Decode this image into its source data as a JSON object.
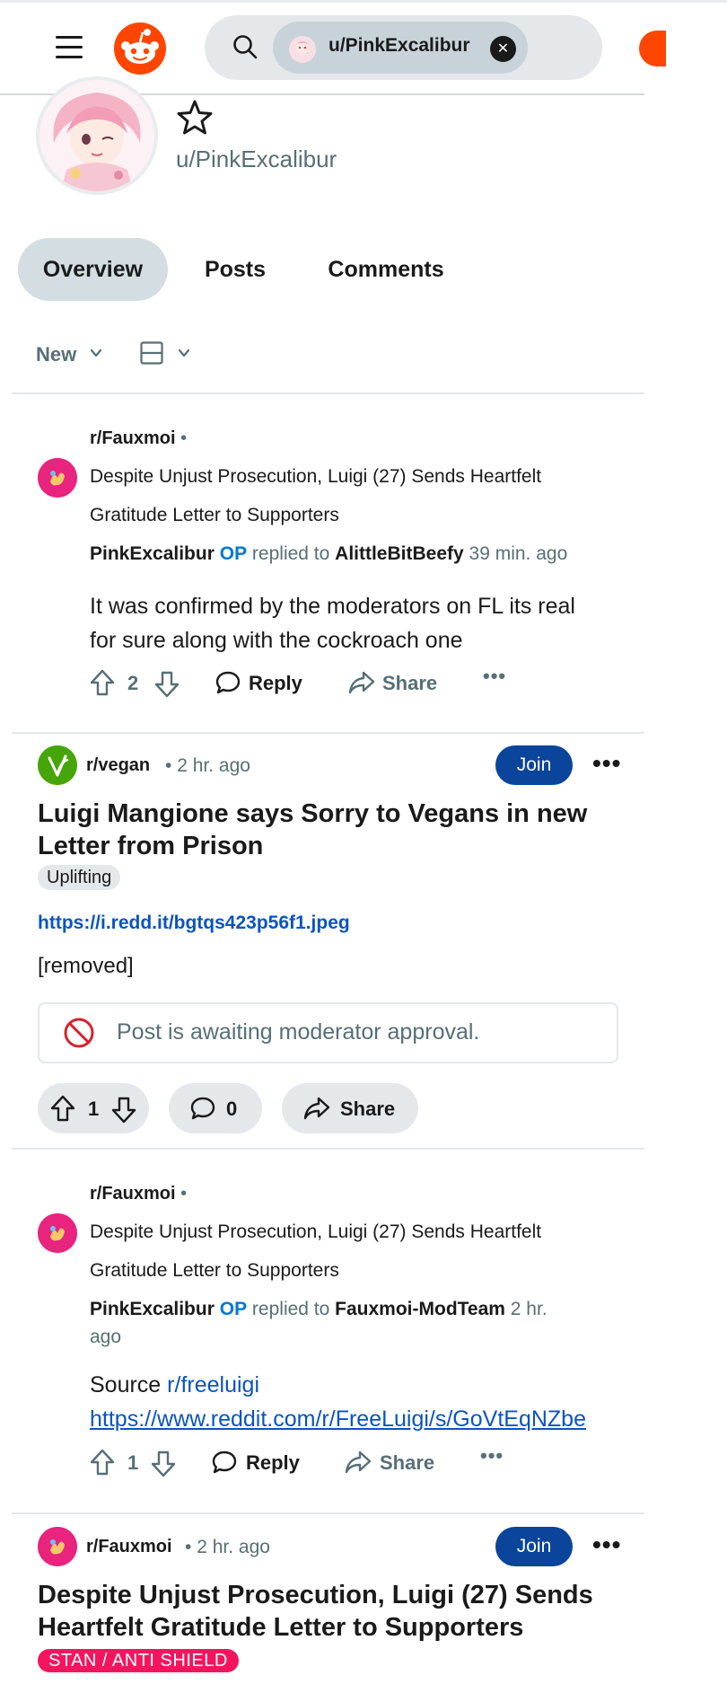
{
  "header": {
    "search_chip_label": "u/PinkExcalibur"
  },
  "profile": {
    "username": "u/PinkExcalibur"
  },
  "tabs": [
    {
      "label": "Overview",
      "active": true
    },
    {
      "label": "Posts",
      "active": false
    },
    {
      "label": "Comments",
      "active": false
    }
  ],
  "sort": {
    "label": "New"
  },
  "feed": {
    "comment1": {
      "subreddit": "r/Fauxmoi",
      "post_title_line1": "Despite Unjust Prosecution, Luigi (27) Sends Heartfelt",
      "post_title_line2": "Gratitude Letter to Supporters",
      "author": "PinkExcalibur",
      "op_badge": "OP",
      "replied_to_text": "replied to",
      "replied_to_user": "AlittleBitBeefy",
      "time": "39 min. ago",
      "body_line1": "It was confirmed by the moderators on FL its real",
      "body_line2": "for sure along with the cockroach one",
      "score": "2",
      "reply_label": "Reply",
      "share_label": "Share"
    },
    "post1": {
      "subreddit": "r/vegan",
      "time": "2 hr. ago",
      "join_label": "Join",
      "title_line1": "Luigi Mangione says Sorry to Vegans in new",
      "title_line2": "Letter from Prison",
      "flair": "Uplifting",
      "link": "https://i.redd.it/bgtqs423p56f1.jpeg",
      "removed_text": "[removed]",
      "notice": "Post is awaiting moderator approval.",
      "score": "1",
      "comments": "0",
      "share_label": "Share"
    },
    "comment2": {
      "subreddit": "r/Fauxmoi",
      "post_title_line1": "Despite Unjust Prosecution, Luigi (27) Sends Heartfelt",
      "post_title_line2": "Gratitude Letter to Supporters",
      "author": "PinkExcalibur",
      "op_badge": "OP",
      "replied_to_text": "replied to",
      "replied_to_user": "Fauxmoi-ModTeam",
      "time_line1": "2 hr.",
      "time_line2": "ago",
      "body_prefix": "Source",
      "body_sub_link": "r/freeluigi",
      "body_url": "https://www.reddit.com/r/FreeLuigi/s/GoVtEqNZbe",
      "score": "1",
      "reply_label": "Reply",
      "share_label": "Share"
    },
    "post2": {
      "subreddit": "r/Fauxmoi",
      "time": "2 hr. ago",
      "join_label": "Join",
      "title_line1": "Despite Unjust Prosecution, Luigi (27) Sends",
      "title_line2": "Heartfelt Gratitude Letter to Supporters",
      "flair": "STAN / ANTI SHIELD"
    }
  },
  "colors": {
    "accent_blue": "#0a449b",
    "link_blue": "#0a54c2",
    "op_blue": "#0079d3",
    "reddit_orange": "#ff4500",
    "flair_pink": "#f5155e",
    "muted": "#576f76"
  }
}
